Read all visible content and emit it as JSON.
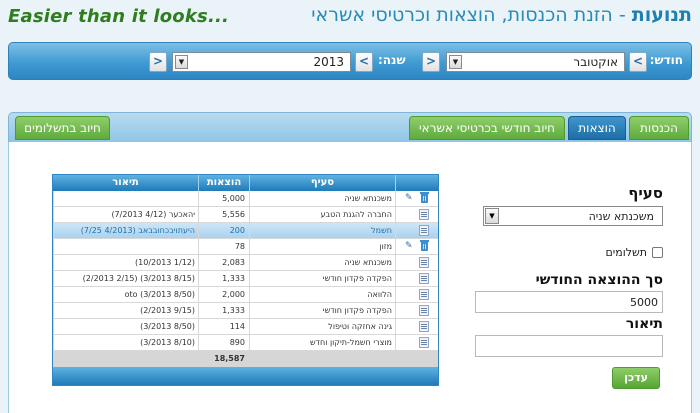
{
  "header": {
    "tagline": "Easier than it looks...",
    "title_bold": "תנועות",
    "title_rest": " - הזנת הכנסות, הוצאות וכרטיסי אשראי"
  },
  "filters": {
    "month_label": "חודש:",
    "month_value": "אוקטובר",
    "year_label": "שנה:",
    "year_value": "2013",
    "prev_glyph": "<",
    "next_glyph": ">",
    "dropdown_glyph": "▼"
  },
  "tabs": [
    {
      "label": "הכנסות",
      "color": "#6bb947"
    },
    {
      "label": "הוצאות",
      "color": "#2a7fb8",
      "active": true
    },
    {
      "label": "חיוב חודשי בכרטיסי אשראי",
      "color": "#6bb947"
    },
    {
      "label": "חיוב בתשלומים",
      "color": "#6bb947"
    }
  ],
  "table": {
    "columns": {
      "desc": "תיאור",
      "amount": "הוצאות",
      "category": "סעיף"
    },
    "rows": [
      {
        "desc": "",
        "amount": "5,000",
        "category": "משכנתא שניה",
        "actions": "edit"
      },
      {
        "desc": "(7/2013 4/12) יהאכער",
        "amount": "5,556",
        "category": "החברה להגנת הטבע",
        "actions": "form"
      },
      {
        "desc": "היעתויבכחובבאב (4/2013 7/25)",
        "amount": "200",
        "category": "חשמל",
        "actions": "form",
        "selected": true
      },
      {
        "desc": "",
        "amount": "78",
        "category": "מזון",
        "actions": "edit"
      },
      {
        "desc": "(10/2013 1/12)",
        "amount": "2,083",
        "category": "משכנתא שניה",
        "actions": "form"
      },
      {
        "desc": "(2/2013 2/15) (3/2013 8/15)",
        "amount": "1,333",
        "category": "הפקדה פקדון חודשי",
        "actions": "form"
      },
      {
        "desc": "oto (3/2013 8/50)",
        "amount": "2,000",
        "category": "הלוואה",
        "actions": "form"
      },
      {
        "desc": "(2/2013 9/15)",
        "amount": "1,333",
        "category": "הפקדה פקדון חודשי",
        "actions": "form"
      },
      {
        "desc": "(3/2013 8/50)",
        "amount": "114",
        "category": "גינה אחזקה וטיפול",
        "actions": "form"
      },
      {
        "desc": "(3/2013 8/10)",
        "amount": "890",
        "category": "מוצרי חשמל-תיקון וחדש",
        "actions": "form"
      }
    ],
    "total": "18,587"
  },
  "form": {
    "category_label": "סעיף",
    "category_value": "משכנתא שניה",
    "installments_label": "תשלומים",
    "amount_label": "סך ההוצאה החודשי",
    "amount_value": "5000",
    "desc_label": "תיאור",
    "desc_value": "",
    "save_label": "עדכן"
  },
  "colors": {
    "accent": "#2a8ab7",
    "tagline": "#2e7d1e",
    "green": "#6bb947"
  }
}
